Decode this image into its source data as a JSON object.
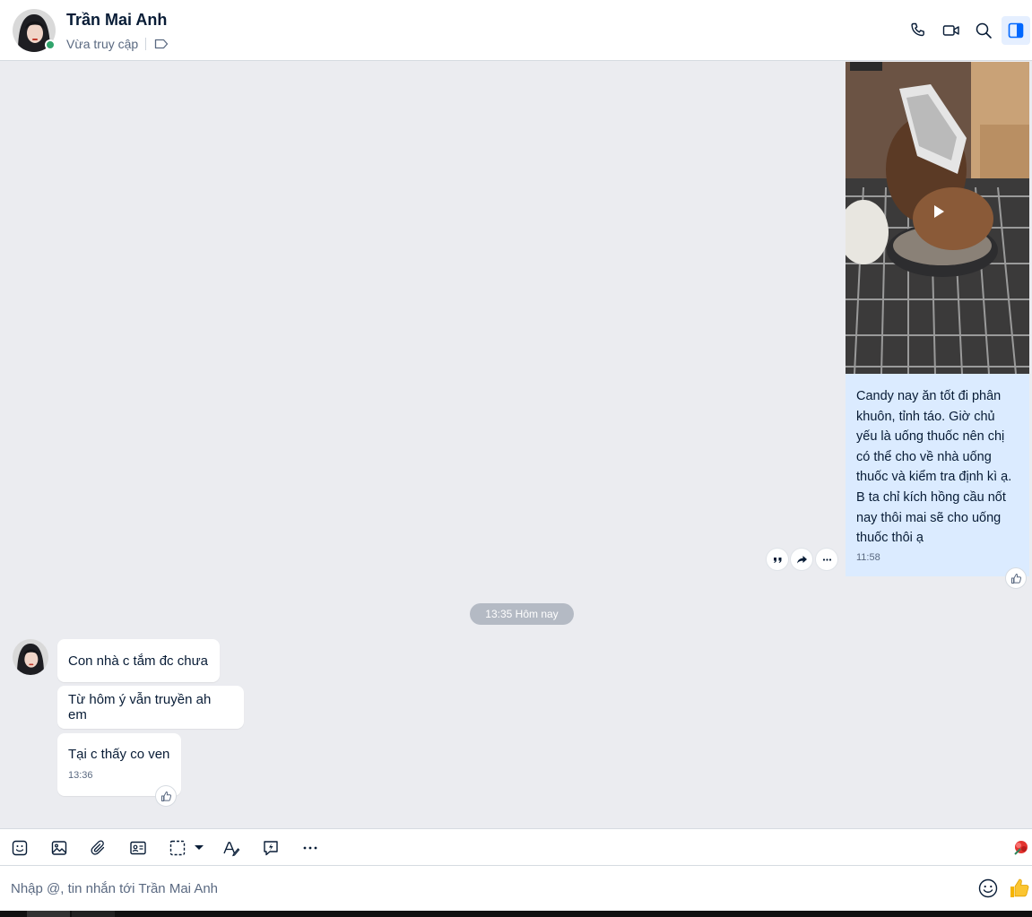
{
  "header": {
    "contact_name": "Trần Mai Anh",
    "status": "Vừa truy cập",
    "online": true
  },
  "chat": {
    "outgoing": {
      "has_video": true,
      "text": "Candy nay ăn tốt đi phân khuôn, tỉnh táo. Giờ chủ yếu là uống thuốc nên chị có thể cho về nhà uống thuốc và kiểm tra định kì ạ. B ta chỉ kích hồng cầu nốt nay thôi mai sẽ cho uống thuốc thôi ạ",
      "time": "11:58"
    },
    "date_divider": "13:35 Hôm nay",
    "incoming": [
      {
        "text": "Con nhà c tắm đc chưa"
      },
      {
        "text": "Từ hôm ý vẫn truyền ah em"
      },
      {
        "text": "Tại c thấy co ven",
        "time": "13:36"
      }
    ]
  },
  "toolbar": {
    "icons": [
      "sticker-icon",
      "image-icon",
      "attach-icon",
      "contact-card-icon",
      "screenshot-icon",
      "format-text-icon",
      "quick-message-icon",
      "more-icon"
    ]
  },
  "composer": {
    "placeholder": "Nhập @, tin nhắn tới Trần Mai Anh"
  },
  "colors": {
    "accent": "#0068ff",
    "outgoing_bubble": "#dbebff",
    "chat_bg": "#ebecf0",
    "online": "#30a46c"
  }
}
